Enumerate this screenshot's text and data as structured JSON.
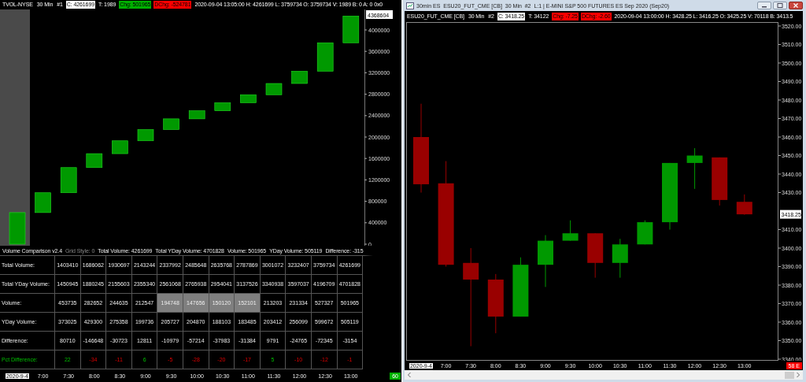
{
  "left_chart": {
    "header": [
      {
        "text": "TVOL-NYSE",
        "kind": "plain"
      },
      {
        "text": "30 Min",
        "kind": "plain"
      },
      {
        "text": "#1",
        "kind": "plain"
      },
      {
        "text": "C: 4261699",
        "kind": "boxed"
      },
      {
        "text": "T: 1989",
        "kind": "plain"
      },
      {
        "text": "Chg: 501965",
        "kind": "tag",
        "color": "#00b000"
      },
      {
        "text": "DChg: -524781",
        "kind": "tag",
        "color": "#ff0000"
      },
      {
        "text": "2020-09-04 13:05:00 H: 4261699 L: 3759734 O: 3759734 V: 1989 B: 0 A: 0 0x0",
        "kind": "plain"
      }
    ],
    "axis_marker": "4368604",
    "y_axis": [
      "4000000",
      "3600000",
      "3200000",
      "2800000",
      "2400000",
      "2000000",
      "1600000",
      "1200000",
      "800000",
      "400000",
      "0"
    ],
    "study": [
      {
        "text": "Volume Comparison v2.4",
        "kind": "plain"
      },
      {
        "text": "Grid Style: 0",
        "kind": "dim"
      },
      {
        "text": "Total Volume: 4261699",
        "kind": "plain"
      },
      {
        "text": "Total YDay Volume: 4701828",
        "kind": "plain"
      },
      {
        "text": "Volume: 501965",
        "kind": "plain"
      },
      {
        "text": "YDay Volume: 505119",
        "kind": "plain"
      },
      {
        "text": "Difference: -315",
        "kind": "plain"
      }
    ],
    "table": [
      {
        "label": "Total Volume:",
        "kind": "plain",
        "cells": [
          "1403410",
          "1686062",
          "1930697",
          "2143244",
          "2337992",
          "2485648",
          "2635768",
          "2787869",
          "3001072",
          "3232407",
          "3759734",
          "4261699"
        ]
      },
      {
        "label": "Total YDay Volume:",
        "kind": "plain",
        "cells": [
          "1450945",
          "1880245",
          "2155603",
          "2355340",
          "2561068",
          "2765938",
          "2954041",
          "3137526",
          "3340938",
          "3597037",
          "4196709",
          "4701828"
        ]
      },
      {
        "label": "Volume:",
        "kind": "highlight",
        "cells": [
          {
            "text": "453735",
            "highlighted": false
          },
          {
            "text": "282652",
            "highlighted": false
          },
          {
            "text": "244635",
            "highlighted": false
          },
          {
            "text": "212547",
            "highlighted": false
          },
          {
            "text": "194748",
            "highlighted": true
          },
          {
            "text": "147656",
            "highlighted": true
          },
          {
            "text": "150120",
            "highlighted": true
          },
          {
            "text": "152101",
            "highlighted": true
          },
          {
            "text": "213203",
            "highlighted": false
          },
          {
            "text": "231334",
            "highlighted": false
          },
          {
            "text": "527327",
            "highlighted": false
          },
          {
            "text": "501965",
            "highlighted": false
          }
        ]
      },
      {
        "label": "YDay Volume:",
        "kind": "plain",
        "cells": [
          "373025",
          "429300",
          "275358",
          "199736",
          "205727",
          "204870",
          "188103",
          "183485",
          "203412",
          "256099",
          "599672",
          "505119"
        ]
      },
      {
        "label": "Difference:",
        "kind": "plain",
        "cells": [
          "80710",
          "-146648",
          "-30723",
          "12811",
          "-10979",
          "-57214",
          "-37983",
          "-31384",
          "9791",
          "-24765",
          "-72345",
          "-3154"
        ]
      },
      {
        "label": "Pct Difference:",
        "kind": "pct",
        "cells": [
          {
            "text": "22",
            "kind": "up"
          },
          {
            "text": "-34",
            "kind": "down"
          },
          {
            "text": "-11",
            "kind": "down"
          },
          {
            "text": "6",
            "kind": "up"
          },
          {
            "text": "-5",
            "kind": "down"
          },
          {
            "text": "-28",
            "kind": "down"
          },
          {
            "text": "-20",
            "kind": "down"
          },
          {
            "text": "-17",
            "kind": "down"
          },
          {
            "text": "5",
            "kind": "up"
          },
          {
            "text": "-10",
            "kind": "down"
          },
          {
            "text": "-12",
            "kind": "down"
          },
          {
            "text": "-1",
            "kind": "down"
          }
        ]
      }
    ],
    "time_axis": [
      "2020-9-4",
      "7:00",
      "7:30",
      "8:00",
      "8:30",
      "9:00",
      "9:30",
      "10:00",
      "10:30",
      "11:00",
      "11:30",
      "12:00",
      "12:30",
      "13:00"
    ],
    "badge": {
      "text": "60",
      "color": "#00b000"
    }
  },
  "right_window": {
    "title": "30min ES  ESU20_FUT_CME [CB]  30 Min  #2  L:1 | E-MINI S&P 500 FUTURES ES Sep 2020 (Sep20)",
    "header": [
      {
        "text": "ESU20_FUT_CME [CB]",
        "kind": "plain"
      },
      {
        "text": "30 Min",
        "kind": "plain"
      },
      {
        "text": "#2",
        "kind": "plain"
      },
      {
        "text": "C: 3418.25",
        "kind": "boxed"
      },
      {
        "text": "T: 34122",
        "kind": "plain"
      },
      {
        "text": "Chg: -7.25",
        "kind": "tag",
        "color": "#ff0000"
      },
      {
        "text": "DChg: -2.60",
        "kind": "tag",
        "color": "#ff0000"
      },
      {
        "text": "2020-09-04 13:00:00 H: 3428.25 L: 3416.25 O: 3425.25 V: 70118 B: 3413.5",
        "kind": "plain"
      }
    ],
    "price_marker": "3418.25",
    "y_axis": [
      "3520.00",
      "3510.00",
      "3500.00",
      "3490.00",
      "3480.00",
      "3470.00",
      "3460.00",
      "3450.00",
      "3440.00",
      "3430.00",
      "3410.00",
      "3400.00",
      "3390.00",
      "3380.00",
      "3370.00",
      "3360.00",
      "3350.00",
      "3340.00"
    ],
    "time_axis": [
      "2020-9-4",
      "7:00",
      "7:30",
      "8:00",
      "8:30",
      "9:00",
      "9:30",
      "10:00",
      "10:30",
      "11:00",
      "11:30",
      "12:00",
      "12:30",
      "13:00"
    ],
    "badge": {
      "text": "58 E",
      "color": "#ff0000"
    }
  }
}
